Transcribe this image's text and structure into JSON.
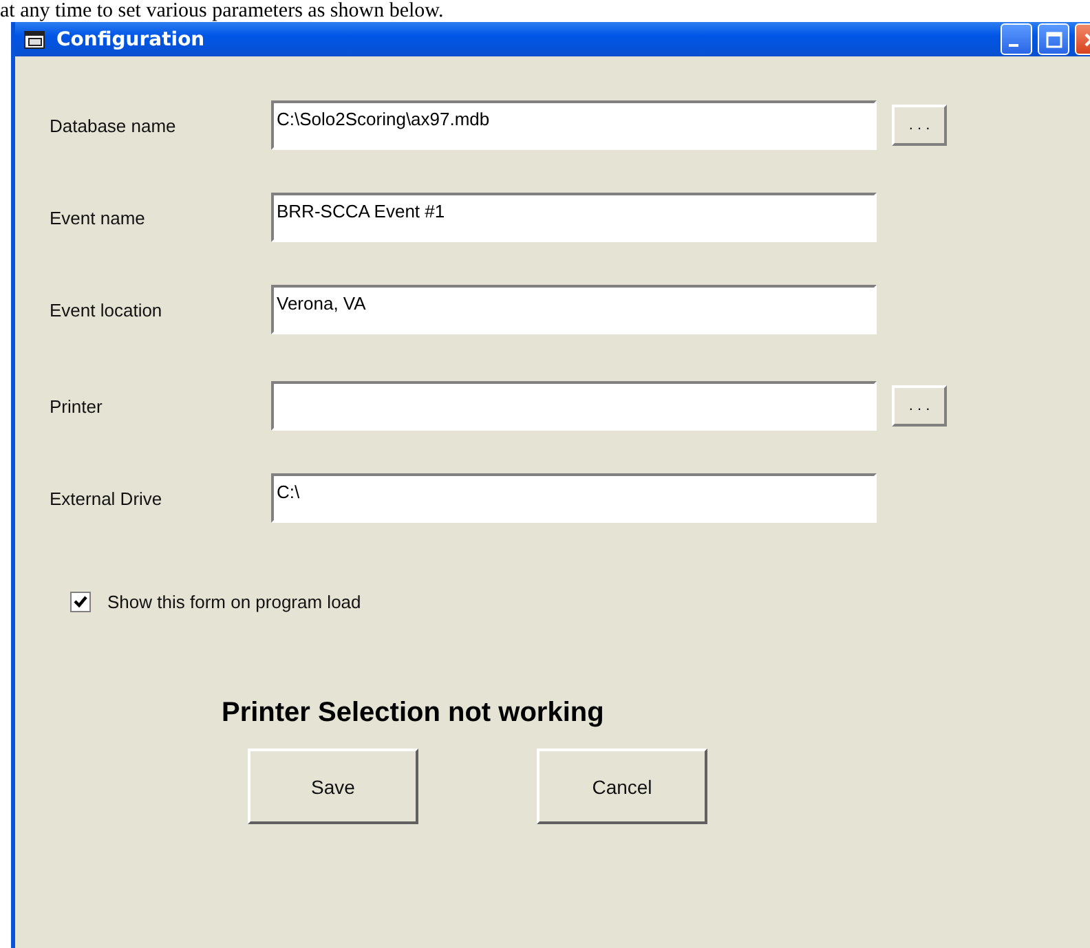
{
  "caption": "at any time to set various parameters as shown below.",
  "window": {
    "title": "Configuration"
  },
  "fields": [
    {
      "label": "Database name",
      "value": "C:\\Solo2Scoring\\ax97.mdb",
      "browse": true,
      "browse_label": ". . ."
    },
    {
      "label": "Event name",
      "value": "BRR-SCCA Event #1",
      "browse": false
    },
    {
      "label": "Event location",
      "value": "Verona, VA",
      "browse": false
    },
    {
      "label": "Printer",
      "browse": true,
      "browse_label": ". . ."
    },
    {
      "label": "External Drive",
      "value": "C:\\",
      "browse": false
    }
  ],
  "checkbox": {
    "label": "Show this form on program load",
    "checked": true
  },
  "warning": "Printer Selection not working",
  "buttons": [
    "Save",
    "Cancel"
  ]
}
